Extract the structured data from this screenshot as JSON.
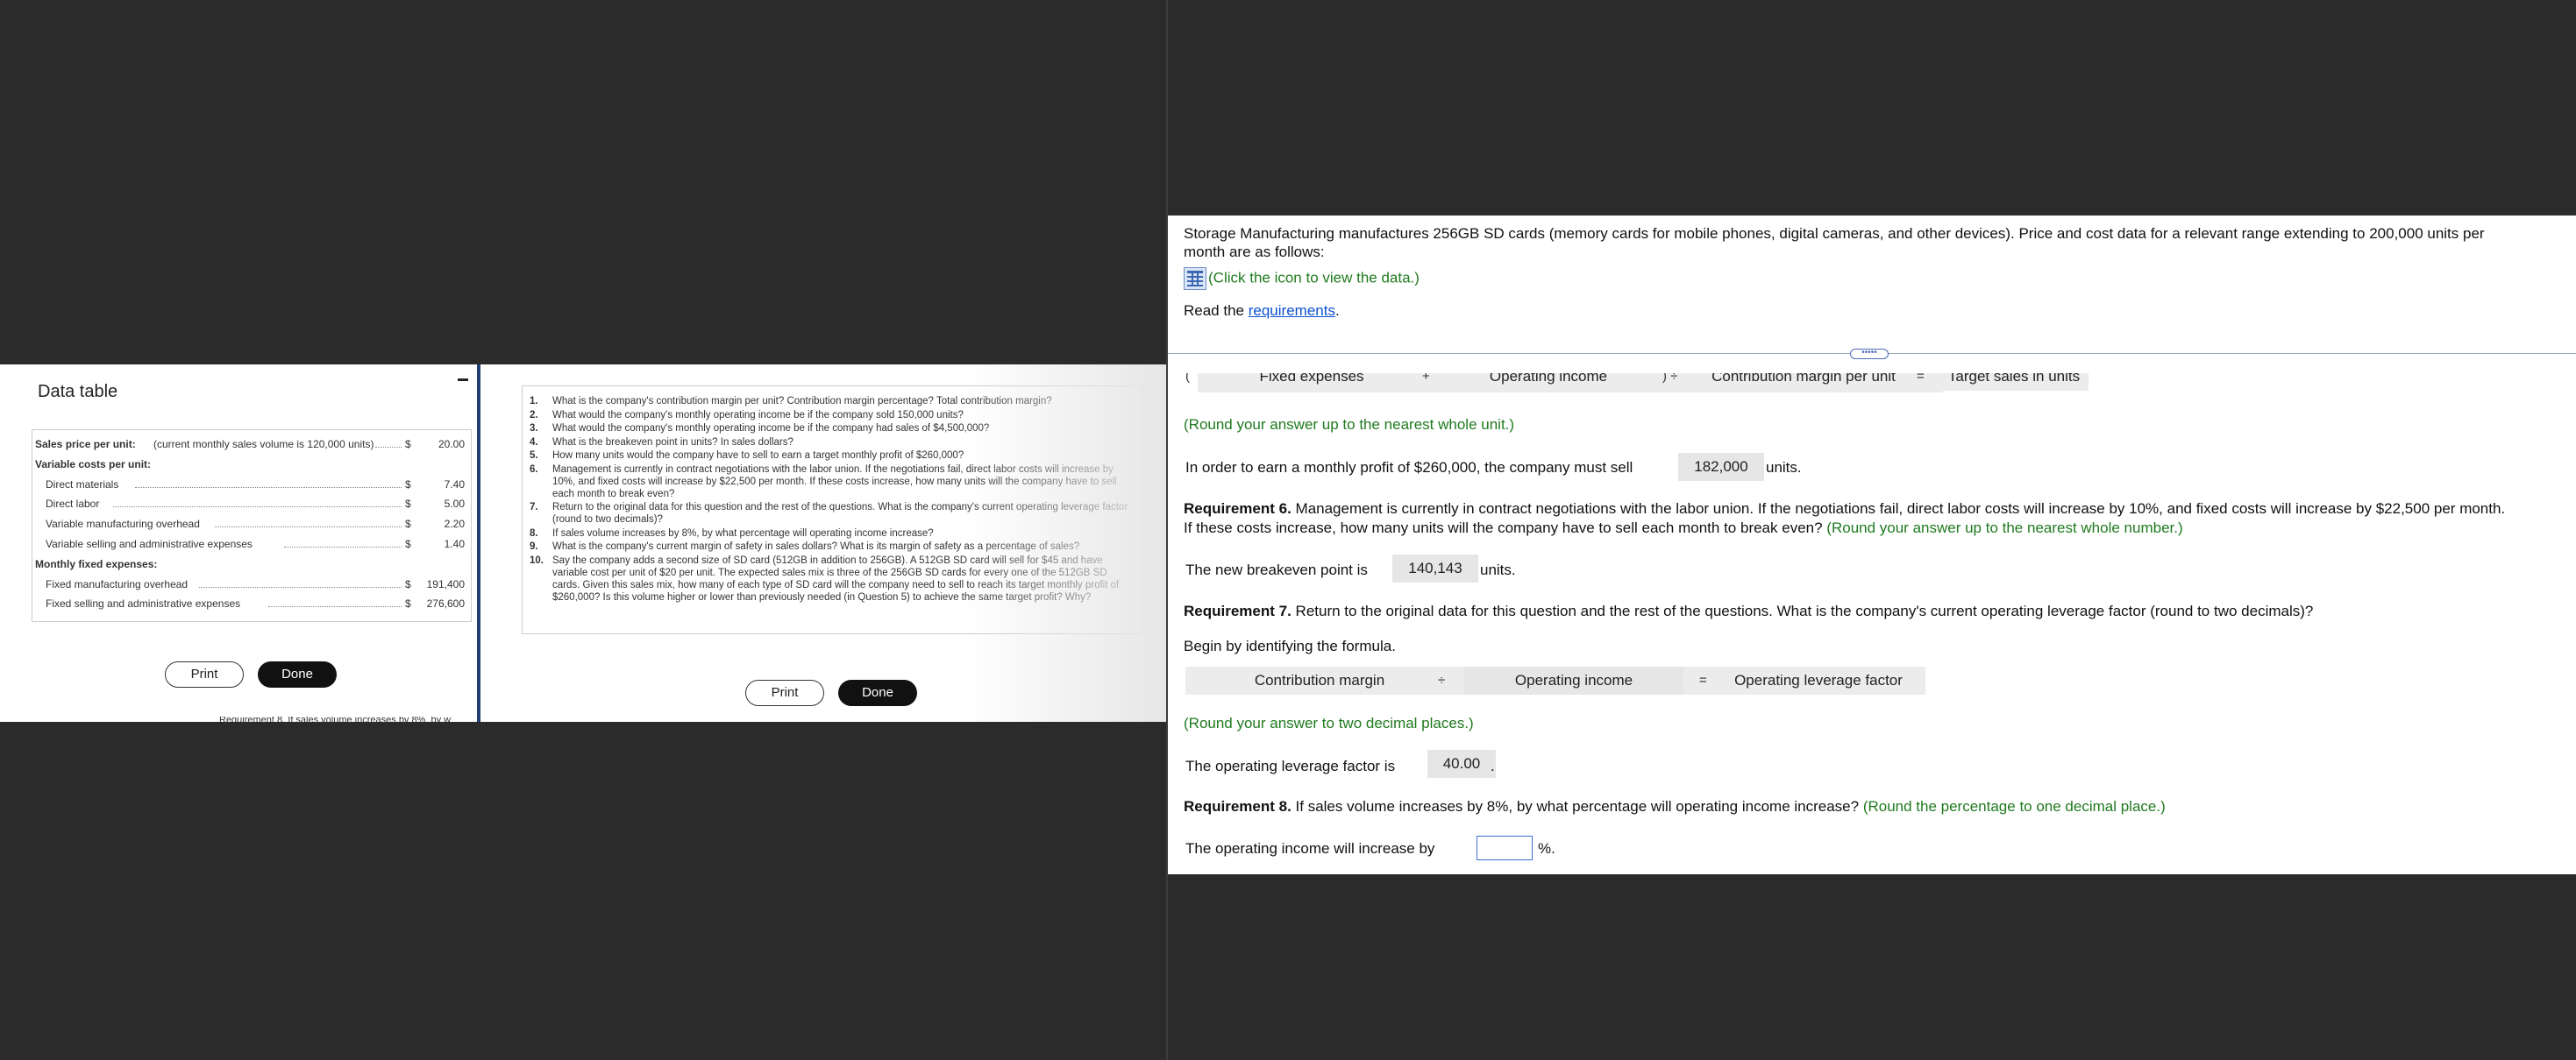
{
  "data_table": {
    "title": "Data table",
    "rows": [
      {
        "label": "Sales price per unit:",
        "note": "(current monthly sales volume is 120,000 units)",
        "currency": "$",
        "value": "20.00",
        "bold": true
      },
      {
        "label": "Variable costs per unit:",
        "note": "",
        "currency": "",
        "value": "",
        "bold": true
      },
      {
        "label": "Direct materials",
        "note": "",
        "currency": "$",
        "value": "7.40",
        "bold": false
      },
      {
        "label": "Direct labor",
        "note": "",
        "currency": "$",
        "value": "5.00",
        "bold": false
      },
      {
        "label": "Variable manufacturing overhead",
        "note": "",
        "currency": "$",
        "value": "2.20",
        "bold": false
      },
      {
        "label": "Variable selling and administrative expenses",
        "note": "",
        "currency": "$",
        "value": "1.40",
        "bold": false
      },
      {
        "label": "Monthly fixed expenses:",
        "note": "",
        "currency": "",
        "value": "",
        "bold": true
      },
      {
        "label": "Fixed manufacturing overhead",
        "note": "",
        "currency": "$",
        "value": "191,400",
        "bold": false
      },
      {
        "label": "Fixed selling and administrative expenses",
        "note": "",
        "currency": "$",
        "value": "276,600",
        "bold": false
      }
    ],
    "print_label": "Print",
    "done_label": "Done"
  },
  "requirements_panel": {
    "items": [
      {
        "num": "1.",
        "text": "What is the company's contribution margin per unit? Contribution margin percentage? Total contribution margin?"
      },
      {
        "num": "2.",
        "text": "What would the company's monthly operating income be if the company sold 150,000 units?"
      },
      {
        "num": "3.",
        "text": "What would the company's monthly operating income be if the company had sales of $4,500,000?"
      },
      {
        "num": "4.",
        "text": "What is the breakeven point in units? In sales dollars?"
      },
      {
        "num": "5.",
        "text": "How many units would the company have to sell to earn a target monthly profit of $260,000?"
      },
      {
        "num": "6.",
        "text": "Management is currently in contract negotiations with the labor union. If the negotiations fail, direct labor costs will increase by 10%, and fixed costs will increase by $22,500 per month. If these costs increase, how many units will the company have to sell each month to break even?"
      },
      {
        "num": "7.",
        "text": "Return to the original data for this question and the rest of the questions. What is the company's current operating leverage factor (round to two decimals)?"
      },
      {
        "num": "8.",
        "text": "If sales volume increases by 8%, by what percentage will operating income increase?"
      },
      {
        "num": "9.",
        "text": "What is the company's current margin of safety in sales dollars? What is its margin of safety as a percentage of sales?"
      },
      {
        "num": "10.",
        "text": "Say the company adds a second size of SD card (512GB in addition to 256GB). A 512GB SD card will sell for $45 and have variable cost per unit of $20 per unit. The expected sales mix is three of the 256GB SD cards for every one of the 512GB SD cards. Given this sales mix, how many of each type of SD card will the company need to sell to reach its target monthly profit of $260,000? Is this volume higher or lower than previously needed (in Question 5) to achieve the same target profit? Why?"
      }
    ],
    "print_label": "Print",
    "done_label": "Done",
    "cut_text": "Requirement 8. If sales volume increases by 8%, by w"
  },
  "main": {
    "intro_line1": "Storage Manufacturing manufactures 256GB SD cards (memory cards for mobile phones, digital cameras, and other devices). Price and cost data for a relevant range extending to 200,000 units per",
    "intro_line2": "month are as follows:",
    "data_link": "(Click the icon to view the data.)",
    "read_prefix": "Read the ",
    "read_link": "requirements",
    "read_suffix": ".",
    "handle_label": "•••••",
    "req5_formula": {
      "open": "(",
      "fixed": "Fixed expenses",
      "plus": "+",
      "opinc": "Operating income",
      "close_div": ") ÷",
      "cm": "Contribution margin per unit",
      "eq": "=",
      "result": "Target sales in units"
    },
    "req5_round": "(Round your answer up to the nearest whole unit.)",
    "req5_answer_pre": "In order to earn a monthly profit of $260,000, the company must sell",
    "req5_answer_val": "182,000",
    "req5_answer_post": "units.",
    "req6_label": "Requirement 6.",
    "req6_text1": " Management is currently in contract negotiations with the labor union. If the negotiations fail, direct labor costs will increase by 10%, and fixed costs will increase by $22,500 per month.",
    "req6_text2": "If these costs increase, how many units will the company have to sell each month to break even?",
    "req6_round": "(Round your answer up to the nearest whole number.)",
    "req6_answer_pre": "The new breakeven point is",
    "req6_answer_val": "140,143",
    "req6_answer_post": "units.",
    "req7_label": "Requirement 7.",
    "req7_text": " Return to the original data for this question and the rest of the questions. What is the company's current operating leverage factor (round to two decimals)?",
    "req7_begin": "Begin by identifying the formula.",
    "req7_formula": {
      "cm": "Contribution margin",
      "div": "÷",
      "opinc": "Operating income",
      "eq": "=",
      "result": "Operating leverage factor"
    },
    "req7_round": "(Round your answer to two decimal places.)",
    "req7_answer_pre": "The operating leverage factor is",
    "req7_answer_val": "40.00",
    "req7_answer_post": ".",
    "req8_label": "Requirement 8.",
    "req8_text": " If sales volume increases by 8%, by what percentage will operating income increase?",
    "req8_round": " (Round the percentage to one decimal place.)",
    "req8_answer_pre": "The operating income will increase by",
    "req8_answer_val": "",
    "req8_answer_post": "%."
  }
}
